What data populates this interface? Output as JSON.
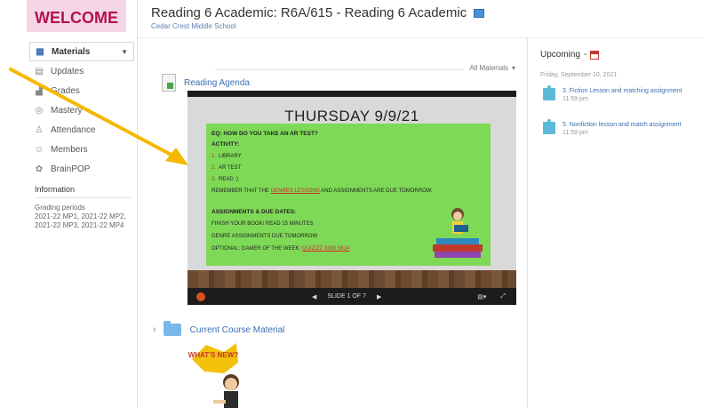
{
  "sidebar": {
    "logo_text": "WELCOME",
    "menu": [
      {
        "label": "Materials",
        "icon": "materials-icon",
        "active": true
      },
      {
        "label": "Updates",
        "icon": "updates-icon"
      },
      {
        "label": "Grades",
        "icon": "grades-icon"
      },
      {
        "label": "Mastery",
        "icon": "mastery-icon"
      },
      {
        "label": "Attendance",
        "icon": "attendance-icon"
      },
      {
        "label": "Members",
        "icon": "members-icon"
      },
      {
        "label": "BrainPOP",
        "icon": "brainpop-icon"
      }
    ],
    "info_title": "Information",
    "grading_label": "Grading periods",
    "grading_value": "2021-22 MP1, 2021-22 MP2, 2021-22 MP3, 2021-22 MP4"
  },
  "header": {
    "course_title": "Reading 6 Academic: R6A/615 - Reading 6 Academic",
    "school": "Cedar Crest Middle School"
  },
  "main": {
    "all_materials": "All Materials",
    "agenda_link": "Reading Agenda",
    "slide": {
      "title": "THURSDAY 9/9/21",
      "question": "EQ: HOW DO YOU TAKE AN AR TEST?",
      "activity_label": "ACTIVITY:",
      "activities": [
        "LIBRARY",
        "AR TEST",
        "READ :)"
      ],
      "reminder_pre": "REMEMBER THAT THE ",
      "reminder_link": "GENRES LESSONS",
      "reminder_post": " AND ASSIGNMENTS ARE DUE TOMORROW.",
      "assign_label": "ASSIGNMENTS & DUE DATES:",
      "assign_1": "FINISH YOUR BOOK/ READ 15 MINUTES",
      "assign_2": "GENRE ASSIGNMENTS DUE TOMORROW",
      "optional_pre": "OPTIONAL:  GAMER OF THE WEEK: ",
      "optional_link": "QUIZIZZ 3390 5814",
      "slide_counter": "SLIDE 1 OF 7"
    },
    "folder_link": "Current Course Material",
    "sticker_text": "WHAT'S NEW?"
  },
  "upcoming": {
    "title": "Upcoming",
    "date": "Friday, September 10, 2021",
    "items": [
      {
        "title": "3. Fiction Lesson and matching assignment",
        "time": "11:59 pm"
      },
      {
        "title": "5. Nonfiction lesson and match assignment",
        "time": "11:59 pm"
      }
    ]
  },
  "colors": {
    "link": "#3a6fb3",
    "slide_green": "#7ed957",
    "arrow": "#f5b800",
    "folder": "#7ab7e9",
    "puzzle": "#5db9d8"
  }
}
